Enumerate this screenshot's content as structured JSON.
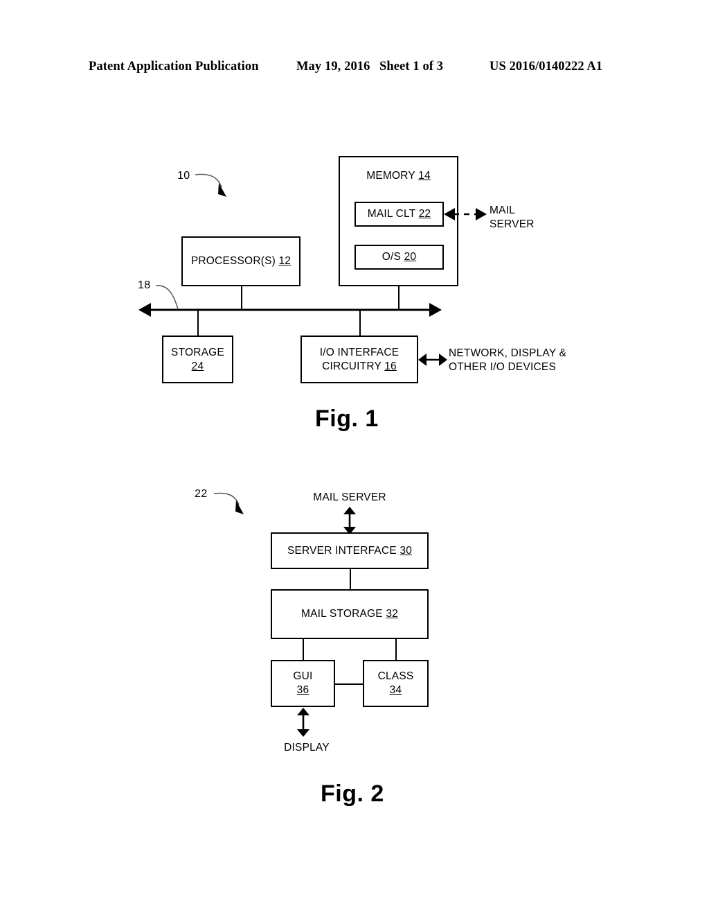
{
  "header": {
    "publication": "Patent Application Publication",
    "date": "May 19, 2016",
    "sheet": "Sheet 1 of 3",
    "patent_number": "US 2016/0140222 A1"
  },
  "figure1": {
    "caption": "Fig. 1",
    "reference_numeral": "10",
    "bus_numeral": "18",
    "boxes": {
      "processor": "PROCESSOR(S) 12",
      "processor_text": "PROCESSOR(S) ",
      "processor_ref": "12",
      "memory_text": "MEMORY ",
      "memory_ref": "14",
      "mail_client_text": "MAIL CLT ",
      "mail_client_ref": "22",
      "os_text": "O/S ",
      "os_ref": "20",
      "storage_text": "STORAGE",
      "storage_ref": "24",
      "io_text": "I/O INTERFACE\nCIRCUITRY ",
      "io_ref": "16"
    },
    "external_labels": {
      "mail_server": "MAIL\nSERVER",
      "io_devices": "NETWORK, DISPLAY &\nOTHER I/O DEVICES"
    }
  },
  "figure2": {
    "caption": "Fig. 2",
    "reference_numeral": "22",
    "top_label": "MAIL SERVER",
    "bottom_label": "DISPLAY",
    "boxes": {
      "server_interface_text": "SERVER INTERFACE ",
      "server_interface_ref": "30",
      "mail_storage_text": "MAIL STORAGE ",
      "mail_storage_ref": "32",
      "gui_text": "GUI",
      "gui_ref": "36",
      "class_text": "CLASS",
      "class_ref": "34"
    }
  },
  "colors": {
    "ink": "#000000",
    "paper": "#ffffff"
  }
}
